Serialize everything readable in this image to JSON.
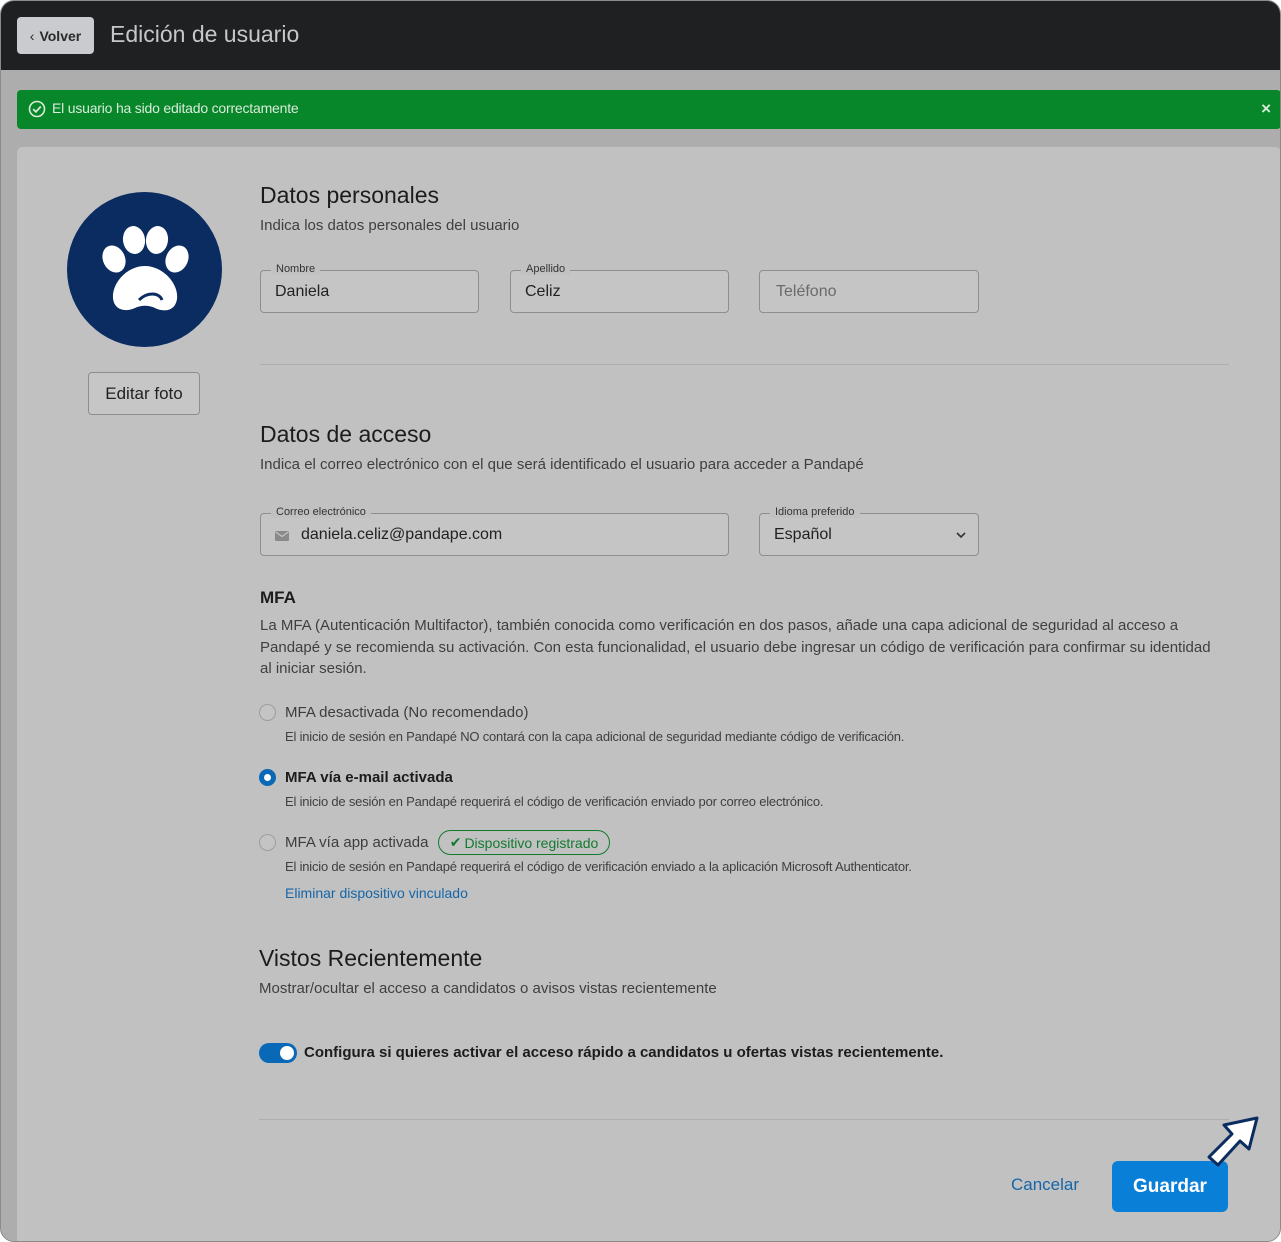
{
  "header": {
    "back_label": "Volver",
    "title": "Edición de usuario"
  },
  "alert": {
    "message": "El usuario ha sido editado correctamente",
    "close_symbol": "×"
  },
  "profile": {
    "edit_photo_label": "Editar foto",
    "avatar_icon": "paw-icon"
  },
  "personal": {
    "title": "Datos personales",
    "subtitle": "Indica los datos personales del usuario",
    "first_name_label": "Nombre",
    "first_name_value": "Daniela",
    "last_name_label": "Apellido",
    "last_name_value": "Celiz",
    "phone_placeholder": "Teléfono"
  },
  "access": {
    "title": "Datos de acceso",
    "subtitle": "Indica el correo electrónico con el que será identificado el usuario para acceder a Pandapé",
    "email_label": "Correo electrónico",
    "email_value": "daniela.celiz@pandape.com",
    "language_label": "Idioma preferido",
    "language_value": "Español"
  },
  "mfa": {
    "title": "MFA",
    "description": "La MFA (Autenticación Multifactor), también conocida como verificación en dos pasos, añade una capa adicional de seguridad al acceso a Pandapé y se recomienda su activación. Con esta funcionalidad, el usuario debe ingresar un código de verificación para confirmar su identidad al iniciar sesión.",
    "options": [
      {
        "label": "MFA desactivada (No recomendado)",
        "desc": "El inicio de sesión en Pandapé NO contará con la capa adicional de seguridad mediante código de verificación.",
        "selected": false
      },
      {
        "label": "MFA vía e-mail activada",
        "desc": "El inicio de sesión en Pandapé requerirá el código de verificación enviado por correo electrónico.",
        "selected": true
      },
      {
        "label": "MFA vía app activada",
        "desc": "El inicio de sesión en Pandapé requerirá el código de verificación enviado a la aplicación Microsoft Authenticator.",
        "selected": false
      }
    ],
    "badge": "Dispositivo registrado",
    "remove_link": "Eliminar dispositivo vinculado"
  },
  "recent": {
    "title": "Vistos Recientemente",
    "subtitle": "Mostrar/ocultar el acceso a candidatos o avisos vistas recientemente",
    "toggle_label": "Configura si quieres activar el acceso rápido a candidatos u ofertas vistas recientemente.",
    "toggle_on": true
  },
  "footer": {
    "cancel_label": "Cancelar",
    "save_label": "Guardar"
  },
  "colors": {
    "accent": "#0a7fd8",
    "success": "#08862a",
    "header_bg": "#1f2022"
  }
}
